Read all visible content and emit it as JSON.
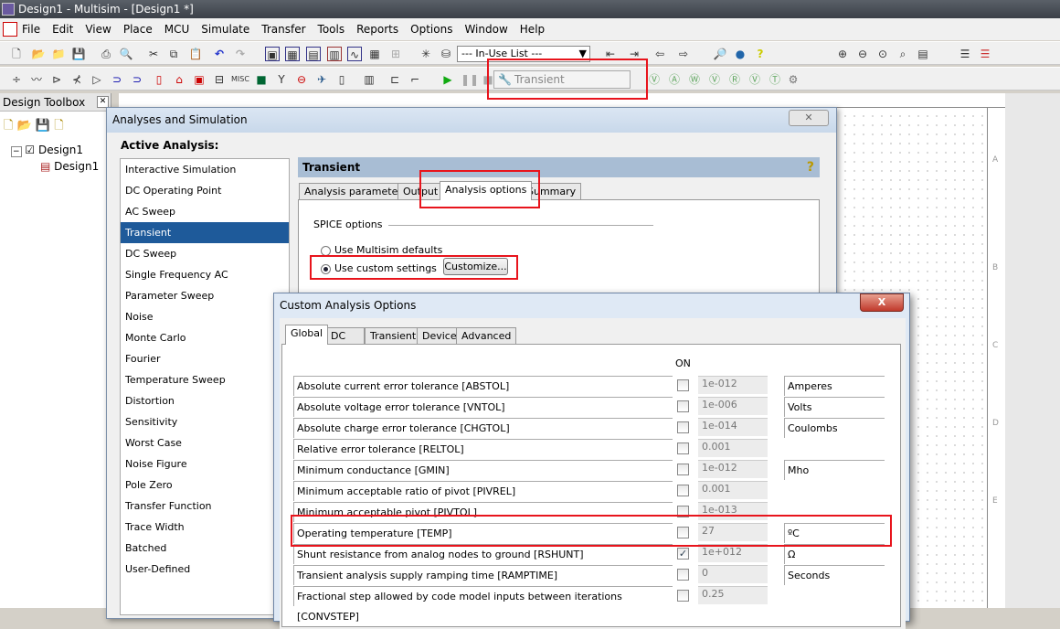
{
  "window": {
    "title": "Design1 - Multisim - [Design1 *]"
  },
  "menu": [
    "File",
    "Edit",
    "View",
    "Place",
    "MCU",
    "Simulate",
    "Transfer",
    "Tools",
    "Reports",
    "Options",
    "Window",
    "Help"
  ],
  "toolbar": {
    "in_use_list": "--- In-Use List ---",
    "analysis_select": "Transient"
  },
  "toolbox": {
    "title": "Design Toolbox",
    "tree": [
      {
        "label": "Design1"
      },
      {
        "label": "Design1"
      }
    ]
  },
  "canvas": {
    "border_letters": [
      "A",
      "B",
      "C",
      "D",
      "E"
    ]
  },
  "analyses_dialog": {
    "title": "Analyses and Simulation",
    "active_label": "Active Analysis:",
    "items": [
      "Interactive Simulation",
      "DC Operating Point",
      "AC Sweep",
      "Transient",
      "DC Sweep",
      "Single Frequency AC",
      "Parameter Sweep",
      "Noise",
      "Monte Carlo",
      "Fourier",
      "Temperature Sweep",
      "Distortion",
      "Sensitivity",
      "Worst Case",
      "Noise Figure",
      "Pole Zero",
      "Transfer Function",
      "Trace Width",
      "Batched",
      "User-Defined"
    ],
    "selected": "Transient",
    "panel_title": "Transient",
    "help": "?",
    "tabs": [
      "Analysis parameters",
      "Output",
      "Analysis options",
      "Summary"
    ],
    "active_tab": "Analysis options",
    "spice_label": "SPICE options",
    "radio_defaults": "Use Multisim defaults",
    "radio_custom": "Use custom settings",
    "customize_button": "Customize..."
  },
  "custom_dialog": {
    "title": "Custom Analysis Options",
    "close": "X",
    "tabs": [
      "Global",
      "DC",
      "Transient",
      "Device",
      "Advanced"
    ],
    "on_header": "ON",
    "rows": [
      {
        "label": "Absolute current error tolerance [ABSTOL]",
        "on": false,
        "value": "1e-012",
        "unit": "Amperes"
      },
      {
        "label": "Absolute voltage error tolerance [VNTOL]",
        "on": false,
        "value": "1e-006",
        "unit": "Volts"
      },
      {
        "label": "Absolute charge error tolerance [CHGTOL]",
        "on": false,
        "value": "1e-014",
        "unit": "Coulombs"
      },
      {
        "label": "Relative error tolerance [RELTOL]",
        "on": false,
        "value": "0.001",
        "unit": ""
      },
      {
        "label": "Minimum conductance [GMIN]",
        "on": false,
        "value": "1e-012",
        "unit": "Mho"
      },
      {
        "label": "Minimum acceptable ratio of pivot [PIVREL]",
        "on": false,
        "value": "0.001",
        "unit": ""
      },
      {
        "label": "Minimum acceptable pivot [PIVTOL]",
        "on": false,
        "value": "1e-013",
        "unit": ""
      },
      {
        "label": "Operating temperature [TEMP]",
        "on": false,
        "value": "27",
        "unit": "ºC"
      },
      {
        "label": "Shunt resistance from analog nodes to ground [RSHUNT]",
        "on": true,
        "value": "1e+012",
        "unit": "Ω"
      },
      {
        "label": "Transient analysis supply ramping time [RAMPTIME]",
        "on": false,
        "value": "0",
        "unit": "Seconds"
      },
      {
        "label": "Fractional step allowed by code model inputs between iterations [CONVSTEP]",
        "on": false,
        "value": "0.25",
        "unit": ""
      }
    ]
  },
  "highlight_color": "#e8141c"
}
